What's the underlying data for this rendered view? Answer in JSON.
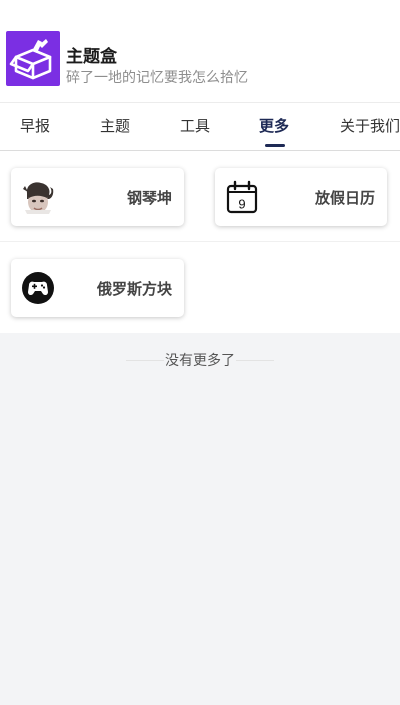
{
  "app": {
    "title": "主题盒",
    "subtitle": "碎了一地的记忆要我怎么拾忆",
    "brand_color": "#7b2fe3",
    "logo_icon": "open-box-icon"
  },
  "tabs": [
    {
      "label": "早报",
      "active": false
    },
    {
      "label": "主题",
      "active": false
    },
    {
      "label": "工具",
      "active": false
    },
    {
      "label": "更多",
      "active": true
    },
    {
      "label": "关于我们",
      "active": false
    }
  ],
  "accent_color": "#1e2a55",
  "cards": [
    {
      "label": "钢琴坤",
      "icon": "avatar-meme-icon"
    },
    {
      "label": "放假日历",
      "icon": "calendar-icon",
      "icon_text": "9"
    },
    {
      "label": "俄罗斯方块",
      "icon": "gamepad-icon"
    }
  ],
  "footer": {
    "no_more_text": "没有更多了"
  }
}
